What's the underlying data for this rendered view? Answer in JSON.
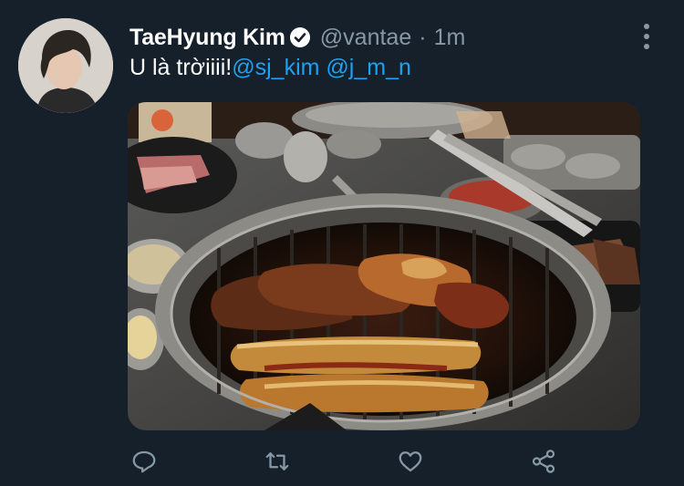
{
  "tweet": {
    "display_name": "TaeHyung Kim",
    "verified": true,
    "handle": "@vantae",
    "separator": "·",
    "timestamp": "1m",
    "text_prefix": "U là trờiiii!",
    "mentions": [
      "@sj_kim",
      "@j_m_n"
    ]
  },
  "media": {
    "description_icon": "food-photo"
  },
  "actions": {
    "reply": "reply-icon",
    "retweet": "retweet-icon",
    "like": "like-icon",
    "share": "share-icon"
  },
  "colors": {
    "background": "#15202b",
    "text": "#ffffff",
    "secondary": "#8899a6",
    "accent": "#1da1f2"
  }
}
